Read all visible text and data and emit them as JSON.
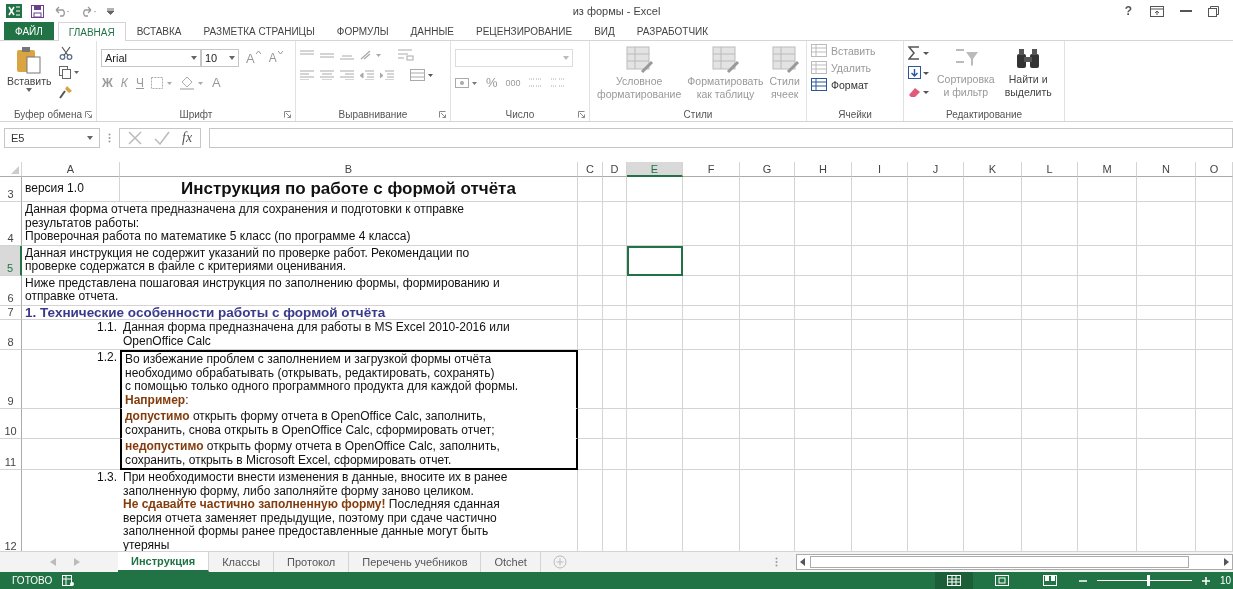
{
  "window": {
    "title": "из формы - Excel",
    "help": "?"
  },
  "ribbon_tabs": [
    {
      "label": "ФАЙЛ",
      "kind": "file",
      "selected": false
    },
    {
      "label": "ГЛАВНАЯ",
      "kind": "tab",
      "selected": true
    },
    {
      "label": "ВСТАВКА",
      "kind": "tab",
      "selected": false
    },
    {
      "label": "РАЗМЕТКА СТРАНИЦЫ",
      "kind": "tab",
      "selected": false
    },
    {
      "label": "ФОРМУЛЫ",
      "kind": "tab",
      "selected": false
    },
    {
      "label": "ДАННЫЕ",
      "kind": "tab",
      "selected": false
    },
    {
      "label": "РЕЦЕНЗИРОВАНИЕ",
      "kind": "tab",
      "selected": false
    },
    {
      "label": "ВИД",
      "kind": "tab",
      "selected": false
    },
    {
      "label": "РАЗРАБОТЧИК",
      "kind": "tab",
      "selected": false
    }
  ],
  "ribbon": {
    "clipboard": {
      "label": "Буфер обмена",
      "paste": "Вставить"
    },
    "font": {
      "label": "Шрифт",
      "font_name": "Arial",
      "font_size": "10",
      "grow": "A",
      "shrink": "A",
      "bold": "Ж",
      "italic": "К",
      "underline": "Ч",
      "font_color": "A"
    },
    "alignment": {
      "label": "Выравнивание"
    },
    "number": {
      "label": "Число",
      "percent": "%",
      "thousands": "000"
    },
    "styles": {
      "label": "Стили",
      "buttons": [
        {
          "lines": [
            "Условное",
            "форматирование"
          ],
          "disabled": true
        },
        {
          "lines": [
            "Форматировать",
            "как таблицу"
          ],
          "disabled": true
        },
        {
          "lines": [
            "Стили",
            "ячеек"
          ],
          "disabled": true
        }
      ]
    },
    "cells": {
      "label": "Ячейки",
      "buttons": [
        {
          "label": "Вставить",
          "disabled": true
        },
        {
          "label": "Удалить",
          "disabled": true
        },
        {
          "label": "Формат",
          "disabled": false
        }
      ]
    },
    "editing": {
      "label": "Редактирование",
      "buttons": [
        {
          "lines": [
            "Сортировка",
            "и фильтр"
          ],
          "disabled": true
        },
        {
          "lines": [
            "Найти и",
            "выделить"
          ],
          "disabled": false
        }
      ]
    }
  },
  "formula_bar": {
    "name_box": "E5",
    "function_label": "fx"
  },
  "columns": [
    {
      "label": "A",
      "selected": false
    },
    {
      "label": "B",
      "selected": false
    },
    {
      "label": "C",
      "selected": false
    },
    {
      "label": "D",
      "selected": false
    },
    {
      "label": "E",
      "selected": true
    },
    {
      "label": "F",
      "selected": false
    },
    {
      "label": "G",
      "selected": false
    },
    {
      "label": "H",
      "selected": false
    },
    {
      "label": "I",
      "selected": false
    },
    {
      "label": "J",
      "selected": false
    },
    {
      "label": "K",
      "selected": false
    },
    {
      "label": "L",
      "selected": false
    },
    {
      "label": "M",
      "selected": false
    },
    {
      "label": "N",
      "selected": false
    },
    {
      "label": "O",
      "selected": false
    }
  ],
  "rows": [
    {
      "number": "3",
      "selected": false,
      "kind": "title",
      "version": "версия 1.0",
      "title": "Инструкция по работе с формой отчёта"
    },
    {
      "number": "4",
      "selected": false,
      "kind": "merged",
      "text": "Данная форма отчета предназначена для сохранения и подготовки к отправке\nрезультатов работы:\nПроверочная работа по математике 5 класс (по программе 4 класса)"
    },
    {
      "number": "5",
      "selected": true,
      "kind": "merged",
      "text": "Данная инструкция не содержит указаний по проверке работ. Рекомендации по\nпроверке содержатся в файле с критериями оценивания."
    },
    {
      "number": "6",
      "selected": false,
      "kind": "merged",
      "text": "Ниже представлена пошаговая инструкция по заполнению формы, формированию и\nотправке отчета."
    },
    {
      "number": "7",
      "selected": false,
      "kind": "heading",
      "text": "1. Технические особенности работы с формой отчёта"
    },
    {
      "number": "8",
      "selected": false,
      "kind": "item",
      "boxed": false,
      "a": "1.1.",
      "b": "Данная форма предназначена для работы в MS Excel 2010-2016 или\nOpenOffice Calc"
    },
    {
      "number": "9",
      "selected": false,
      "kind": "item",
      "boxed": true,
      "a": "1.2.",
      "b": "Во избежание проблем с заполнением и загрузкой формы отчёта\nнеобходимо обрабатывать (открывать, редактировать, сохранять)\nс помощью только одного программного продукта для каждой формы.\n**Например**:"
    },
    {
      "number": "10",
      "selected": false,
      "kind": "item",
      "boxed": true,
      "b": "**допустимо** открыть форму отчета в OpenOffice Calc, заполнить,\nсохранить, снова открыть в OpenOffice Calc, сформировать отчет;"
    },
    {
      "number": "11",
      "selected": false,
      "kind": "item",
      "boxed": true,
      "b": "**недопустимо** открыть форму отчета в OpenOffice Calc, заполнить,\nсохранить, открыть в Microsoft Excel, сформировать отчет."
    },
    {
      "number": "12",
      "selected": false,
      "kind": "item",
      "boxed": false,
      "a": "1.3.",
      "b": "При необходимости внести изменения в данные, вносите их в ранее\nзаполненную форму, либо заполняйте форму заново целиком.\n**Не сдавайте частично заполненную форму!** Последняя сданная\nверсия отчета заменяет предыдущие, поэтому при сдаче частично\nзаполненной формы ранее предоставленные данные могут быть\nутеряны"
    }
  ],
  "sheet_tabs": [
    {
      "label": "Инструкция",
      "selected": true
    },
    {
      "label": "Классы",
      "selected": false
    },
    {
      "label": "Протокол",
      "selected": false
    },
    {
      "label": "Перечень учебников",
      "selected": false
    },
    {
      "label": "Otchet",
      "selected": false
    }
  ],
  "status_bar": {
    "status": "ГОТОВО",
    "zoom_slider": {
      "level": 0.55
    },
    "zoom": "10"
  }
}
